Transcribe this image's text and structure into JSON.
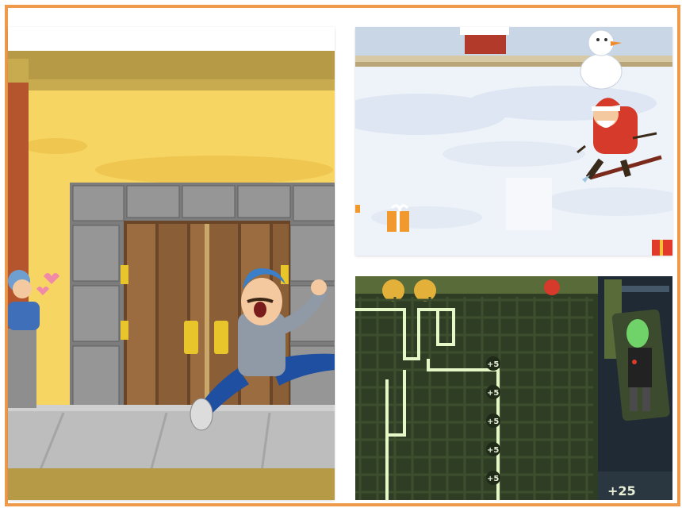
{
  "gallery": {
    "border_color": "#ef9a4a",
    "thumbnails": [
      {
        "name": "street-door-game"
      },
      {
        "name": "santa-ski-game"
      },
      {
        "name": "pipe-maze-game"
      }
    ]
  },
  "maze_game": {
    "bonus_labels": [
      "+5",
      "+5",
      "+5",
      "+5",
      "+5"
    ],
    "score_label": "+25",
    "grid_color": "#3c4e2e",
    "glow_color": "#e6f7c8"
  },
  "ski_game": {
    "gift_color": "#f2992e",
    "santa_color": "#d63a2a"
  },
  "street_game": {
    "wall_color": "#f7d562",
    "door_color": "#8a6239",
    "stone_color": "#8f8f8f"
  }
}
